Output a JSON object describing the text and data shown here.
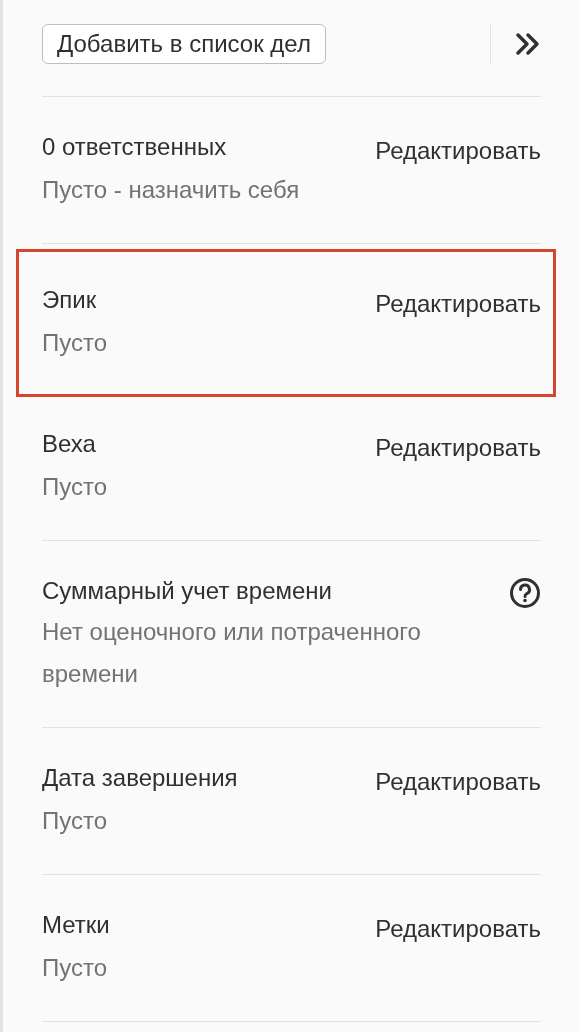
{
  "todo_button": {
    "label": "Добавить в список дел"
  },
  "sections": [
    {
      "title": "0 ответственных",
      "kind": "edit",
      "action": "Редактировать",
      "value": "Пусто - назначить себя",
      "highlighted": false
    },
    {
      "title": "Эпик",
      "kind": "edit",
      "action": "Редактировать",
      "value": "Пусто",
      "highlighted": true
    },
    {
      "title": "Веха",
      "kind": "edit",
      "action": "Редактировать",
      "value": "Пусто",
      "highlighted": false
    },
    {
      "title": "Суммарный учет времени",
      "kind": "help",
      "value": "Нет оценочного или потраченного времени",
      "highlighted": false
    },
    {
      "title": "Дата завершения",
      "kind": "edit",
      "action": "Редактировать",
      "value": "Пусто",
      "highlighted": false
    },
    {
      "title": "Метки",
      "kind": "edit",
      "action": "Редактировать",
      "value": "Пусто",
      "highlighted": false
    }
  ]
}
